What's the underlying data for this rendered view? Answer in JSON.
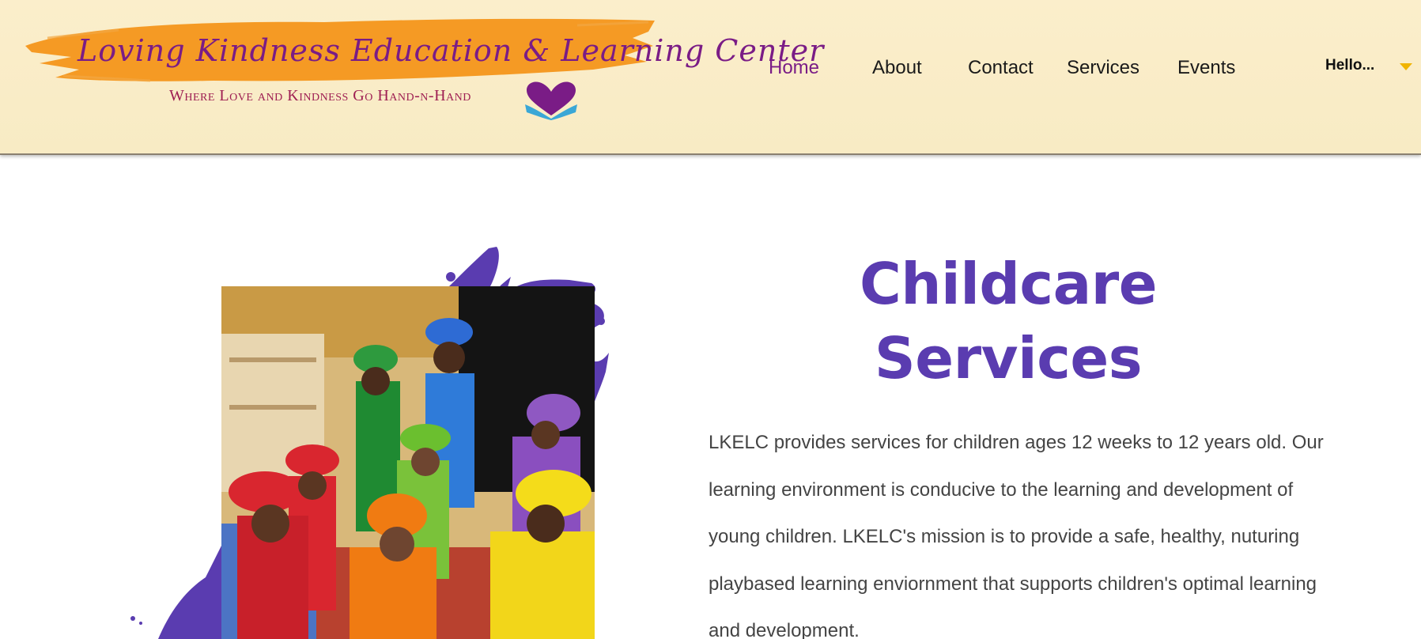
{
  "header": {
    "logo_title": "Loving Kindness Education & Learning Center",
    "logo_tagline": "Where Love and Kindness Go Hand-n-Hand",
    "brand_colors": {
      "stroke": "#f59a24",
      "title": "#7a1c86",
      "tagline": "#9e1e52",
      "heart": "#7a1c86",
      "hands": "#3aa7d6"
    }
  },
  "nav": {
    "items": [
      {
        "label": "Home",
        "active": true
      },
      {
        "label": "About",
        "active": false
      },
      {
        "label": "Contact",
        "active": false
      },
      {
        "label": "Services",
        "active": false
      },
      {
        "label": "Events",
        "active": false
      }
    ],
    "user_label": "Hello...",
    "user_icon": "chevron-down-icon",
    "accent": "#7a1c86"
  },
  "main": {
    "heading_line1": "Childcare",
    "heading_line2": "Services",
    "heading_color": "#5a3cb0",
    "paragraph": "LKELC provides services for children ages 12 weeks to 12 years old. Our learning environment is conducive to the learning and development of young children. LKELC's mission is to provide a safe, healthy, nuturing playbased learning enviornment that supports children's optimal learning and development.",
    "photo_icon": "children-in-chef-hats-photo"
  }
}
